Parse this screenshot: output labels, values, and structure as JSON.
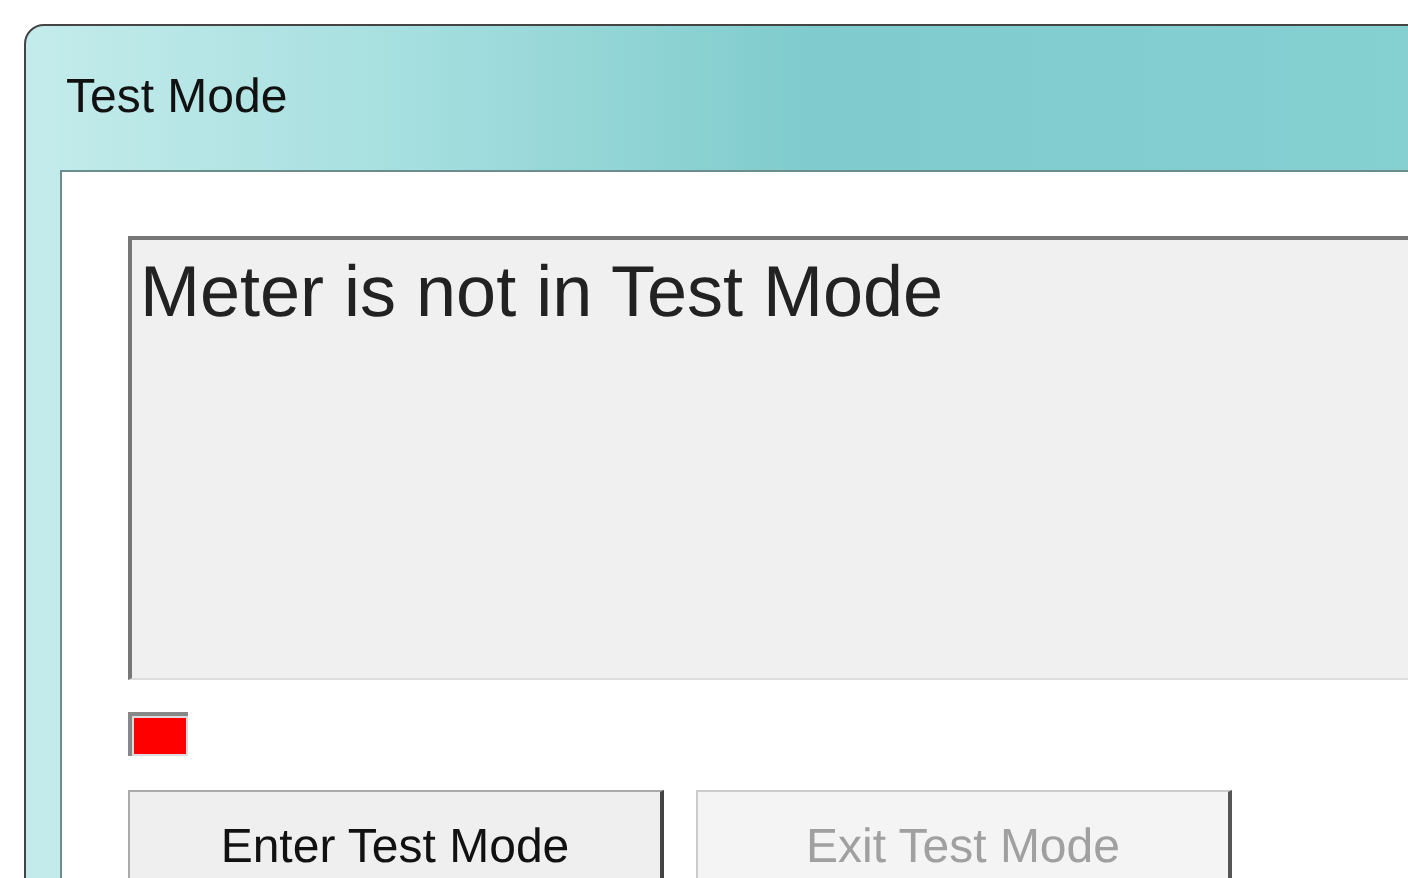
{
  "window": {
    "title": "Test Mode"
  },
  "status_box": {
    "text": "Meter is not in Test Mode"
  },
  "indicator": {
    "color": "#ff0000"
  },
  "buttons": [
    {
      "label": "Enter Test Mode",
      "disabled": false
    },
    {
      "label": "Exit Test Mode",
      "disabled": true
    }
  ]
}
